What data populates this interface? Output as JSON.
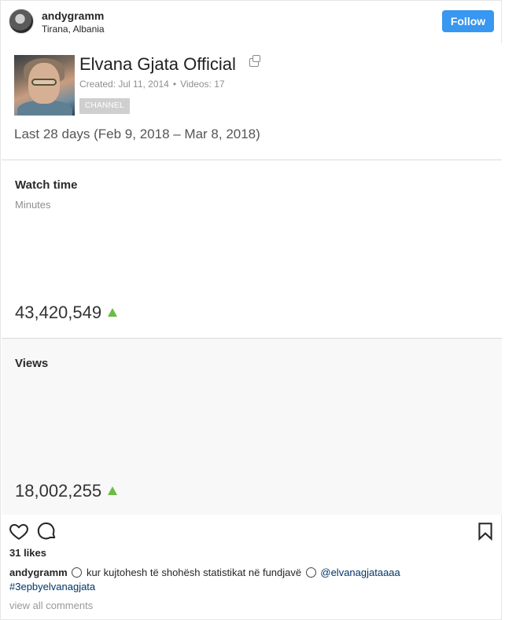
{
  "post": {
    "username": "andygramm",
    "location": "Tirana, Albania",
    "follow_label": "Follow",
    "likes": "31 likes",
    "caption_text_before": "kur kujtohesh të shohësh statistikat në fundjavë",
    "mention": "@elvanagjataaaa",
    "hashtag": "#3epbyelvanagjata",
    "view_all_comments": "view all comments"
  },
  "channel": {
    "name": "Elvana Gjata Official",
    "created": "Created: Jul 11, 2014",
    "videos": "Videos: 17",
    "badge": "CHANNEL",
    "period": "Last 28 days (Feb 9, 2018 – Mar 8, 2018)"
  },
  "metrics": {
    "watch_time": {
      "title": "Watch time",
      "unit": "Minutes",
      "value": "43,420,549",
      "trend": "up"
    },
    "views": {
      "title": "Views",
      "value": "18,002,255",
      "trend": "up"
    }
  },
  "colors": {
    "follow_bg": "#3897f0",
    "trend_up": "#6cbb45",
    "mention": "#003569"
  },
  "icons": [
    "heart-icon",
    "comment-icon",
    "bookmark-icon",
    "external-link-icon",
    "emoji-icon"
  ]
}
